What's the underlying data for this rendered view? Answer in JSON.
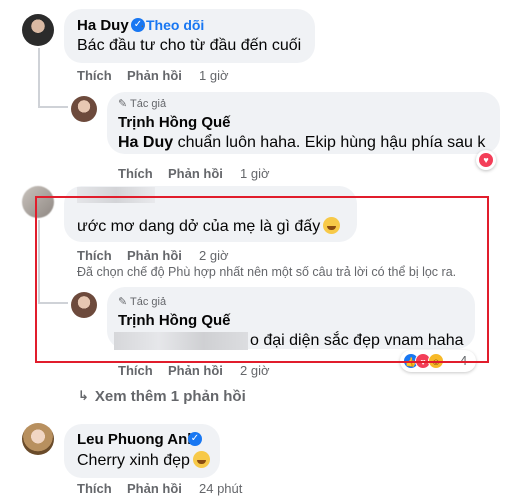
{
  "comments": [
    {
      "author": "Ha Duy",
      "follow_label": "Theo dõi",
      "text": "Bác đầu tư cho từ đầu đến cuối",
      "like_label": "Thích",
      "reply_label": "Phản hồi",
      "time": "1 giờ",
      "reply": {
        "badge": "Tác giả",
        "author": "Trịnh Hồng Quế",
        "mention": "Ha Duy",
        "text": " chuẩn luôn haha. Ekip hùng hậu phía sau k",
        "like_label": "Thích",
        "reply_label": "Phản hồi",
        "time": "1 giờ"
      }
    },
    {
      "text": "ước mơ dang dở của mẹ là gì đấy",
      "like_label": "Thích",
      "reply_label": "Phản hồi",
      "time": "2 giờ",
      "filter_notice": "Đã chọn chế độ Phù hợp nhất nên một số câu trả lời có thể bị lọc ra.",
      "reply": {
        "badge": "Tác giả",
        "author": "Trịnh Hồng Quế",
        "text": "o đại diện sắc đẹp vnam haha",
        "like_label": "Thích",
        "reply_label": "Phản hồi",
        "time": "2 giờ",
        "reaction_count": "4"
      },
      "view_more": "Xem thêm 1 phản hồi"
    },
    {
      "author": "Leu Phuong Anh",
      "text": "Cherry xinh đẹp",
      "like_label": "Thích",
      "reply_label": "Phản hồi",
      "time": "24 phút"
    }
  ],
  "colors": {
    "highlight_border": "#e11d2c",
    "link_blue": "#1877f2",
    "bubble": "#f0f2f5",
    "meta_gray": "#65676b"
  },
  "icons": {
    "verified": "verified-badge-icon",
    "author_pen": "pen-icon",
    "heart_reaction": "heart-reaction-icon",
    "reply_arrow": "reply-arrow-icon",
    "emoji": "emoji-icon"
  }
}
